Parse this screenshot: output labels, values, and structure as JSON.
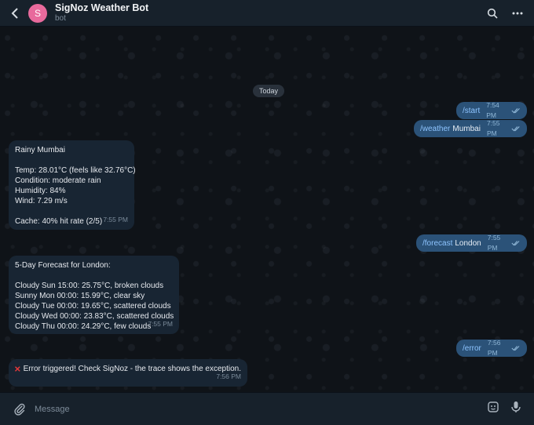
{
  "header": {
    "back_icon": "back-arrow-icon",
    "avatar_letter": "S",
    "avatar_color": "#e86a9c",
    "title": "SigNoz Weather Bot",
    "subtitle": "bot",
    "search_icon": "search-icon",
    "more_icon": "more-vertical-icon"
  },
  "chat": {
    "date_pill": "Today",
    "messages": [
      {
        "dir": "out",
        "cmd": "/start",
        "arg": "",
        "time": "7:54 PM"
      },
      {
        "dir": "out",
        "cmd": "/weather",
        "arg": "Mumbai",
        "time": "7:55 PM"
      },
      {
        "dir": "in",
        "lines": [
          "Rainy Mumbai",
          "",
          "Temp: 28.01°C (feels like 32.76°C)",
          "Condition: moderate rain",
          "Humidity: 84%",
          "Wind: 7.29 m/s",
          "",
          "Cache: 40% hit rate (2/5)"
        ],
        "time": "7:55 PM"
      },
      {
        "dir": "out",
        "cmd": "/forecast",
        "arg": "London",
        "time": "7:55 PM"
      },
      {
        "dir": "in",
        "lines": [
          "5-Day Forecast for London:",
          "",
          "Cloudy Sun 15:00: 25.75°C, broken clouds",
          "Sunny Mon 00:00: 15.99°C, clear sky",
          "Cloudy Tue 00:00: 19.65°C, scattered clouds",
          "Cloudy Wed 00:00: 23.83°C, scattered clouds",
          "Cloudy Thu 00:00: 24.29°C, few clouds"
        ],
        "time": "7:55 PM"
      },
      {
        "dir": "out",
        "cmd": "/error",
        "arg": "",
        "time": "7:56 PM"
      },
      {
        "dir": "in",
        "lines": [
          "Error triggered! Check SigNoz - the trace shows the exception."
        ],
        "time": "7:56 PM"
      }
    ]
  },
  "composer": {
    "attach_icon": "paperclip-icon",
    "placeholder": "Message",
    "sticker_icon": "sticker-icon",
    "mic_icon": "microphone-icon"
  },
  "colors": {
    "outgoing_bubble": "#2b5278",
    "incoming_bubble": "#182533",
    "command_link": "#8ec4ff",
    "error_cross": "#e5393b"
  }
}
